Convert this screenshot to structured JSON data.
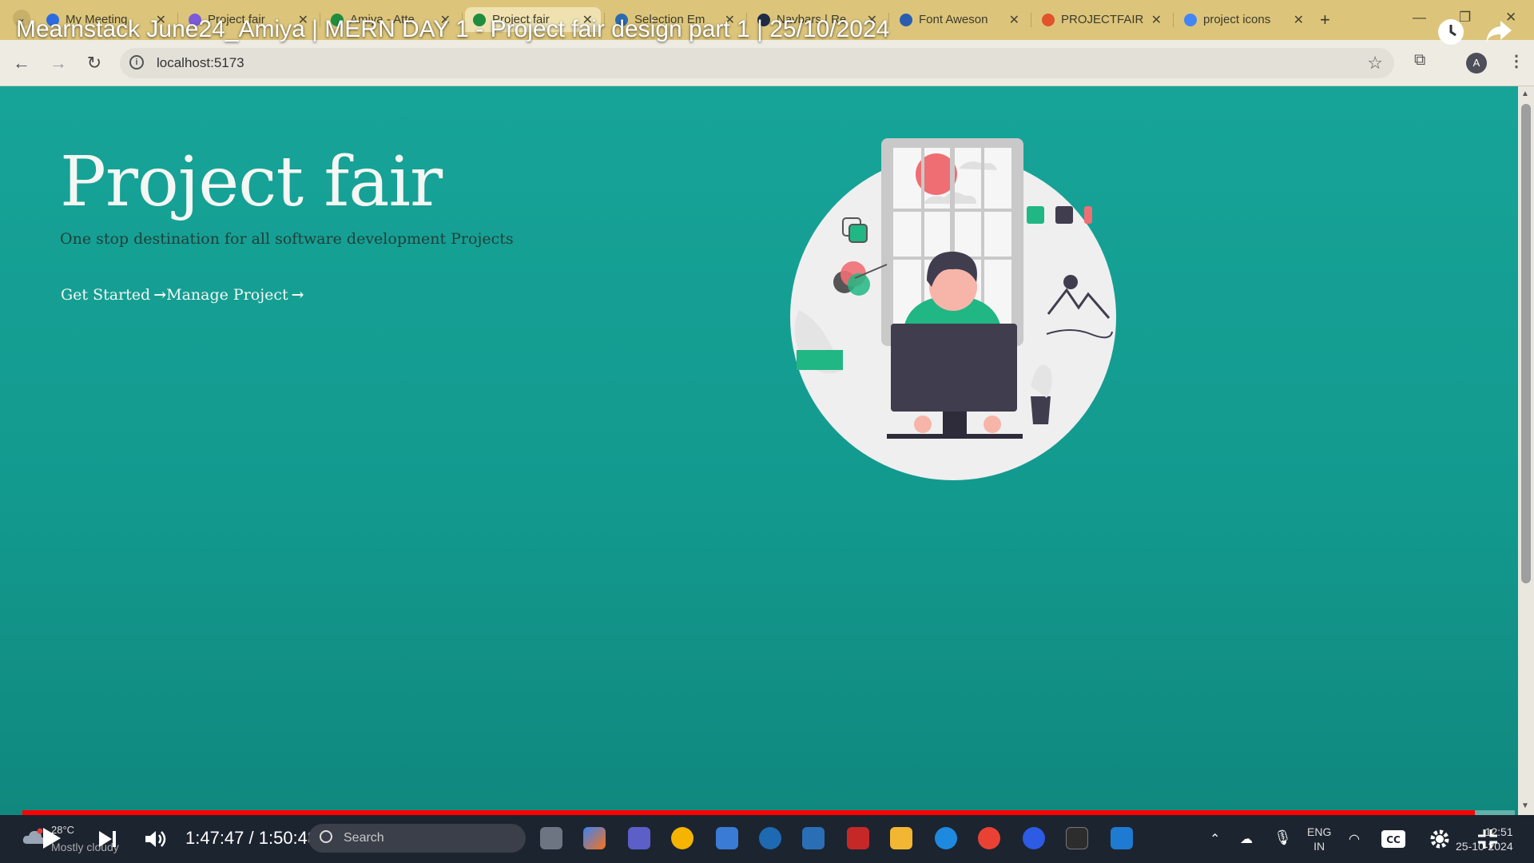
{
  "video": {
    "title": "Mearnstack June24_Amiya | MERN DAY 1 - Project fair design part 1 | 25/10/2024",
    "time_display": "1:47:47 / 1:50:48",
    "progress": 0.973
  },
  "browser": {
    "tabs": [
      {
        "label": "My Meeting",
        "icon": "zoom-icon",
        "color": "#2d6ce0"
      },
      {
        "label": "Project fair",
        "icon": "vite-icon",
        "color": "#7b5cd6"
      },
      {
        "label": "Amiya - Atte",
        "icon": "sheets-icon",
        "color": "#1e8e3e"
      },
      {
        "label": "Project fair",
        "icon": "project-fair-icon",
        "color": "#1e8e3e"
      },
      {
        "label": "Selection Em",
        "icon": "selection-icon",
        "color": "#2b6cb0"
      },
      {
        "label": "Navbars | Re",
        "icon": "react-icon",
        "color": "#1f2a44"
      },
      {
        "label": "Font Aweson",
        "icon": "flag-icon",
        "color": "#2a5db0"
      },
      {
        "label": "PROJECTFAIR",
        "icon": "figma-icon",
        "color": "#e2522b"
      },
      {
        "label": "project icons",
        "icon": "google-icon",
        "color": "#4285f4"
      }
    ],
    "active_tab_index": 3,
    "url": "localhost:5173",
    "avatar_letter": "A"
  },
  "page": {
    "hero_title": "Project fair",
    "hero_subtitle": "One stop destination for all software development Projects",
    "links": [
      {
        "label": "Get Started"
      },
      {
        "label": "Manage Project"
      }
    ],
    "colors": {
      "background": "#17a498",
      "title": "#f4f7f3",
      "subtitle": "#1f3f3a"
    }
  },
  "taskbar": {
    "weather_temp": "28°C",
    "weather_desc": "Mostly cloudy",
    "search_placeholder": "Search",
    "lang_top": "ENG",
    "lang_bottom": "IN",
    "clock_time": "12:51",
    "clock_date": "25-10-2024"
  }
}
